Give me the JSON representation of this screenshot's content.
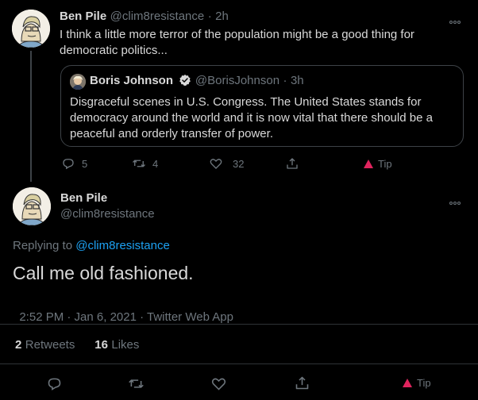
{
  "reply_tweet": {
    "author_name": "Ben Pile",
    "author_handle": "@clim8resistance",
    "separator": "·",
    "time": "2h",
    "text": "I think a little more terror of the population might be a good thing for democratic politics...",
    "actions": {
      "replies": "5",
      "retweets": "4",
      "likes": "32",
      "tip_label": "Tip"
    }
  },
  "quoted_tweet": {
    "author_name": "Boris Johnson",
    "author_handle": "@BorisJohnson",
    "separator": "·",
    "time": "3h",
    "text": "Disgraceful scenes in U.S. Congress. The United States stands for democracy around the world and it is now vital that there should be a peaceful and orderly transfer of power."
  },
  "main_tweet": {
    "author_name": "Ben Pile",
    "author_handle": "@clim8resistance",
    "replying_to_label": "Replying to",
    "replying_to_handle": "@clim8resistance",
    "text": "Call me old fashioned.",
    "timestamp": "2:52 PM · Jan 6, 2021 · ",
    "source": "Twitter Web App",
    "retweets_count": "2",
    "retweets_label": "Retweets",
    "likes_count": "16",
    "likes_label": "Likes",
    "tip_label": "Tip"
  },
  "colors": {
    "background": "#000000",
    "text": "#d9d9d9",
    "muted": "#6e767d",
    "link": "#1da1f2",
    "divider": "#2f3336",
    "tip": "#e0245e"
  },
  "icons": [
    "reply-icon",
    "retweet-icon",
    "like-icon",
    "share-icon",
    "tip-icon",
    "more-icon",
    "verified-badge-icon"
  ]
}
